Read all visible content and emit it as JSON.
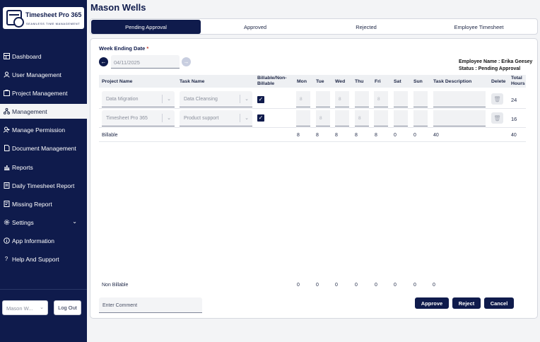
{
  "app": {
    "logo_title": "Timesheet Pro 365",
    "logo_subtitle": "SEAMLESS TIME MANAGEMENT"
  },
  "sidebar": {
    "items": [
      {
        "label": "Dashboard",
        "icon": "dashboard-icon"
      },
      {
        "label": "User Management",
        "icon": "user-icon"
      },
      {
        "label": "Project Management",
        "icon": "project-icon"
      },
      {
        "label": "Management",
        "icon": "hierarchy-icon",
        "active": true
      },
      {
        "label": "Manage Permission",
        "icon": "permission-icon"
      },
      {
        "label": "Document Management",
        "icon": "document-icon"
      },
      {
        "label": "Reports",
        "icon": "reports-icon"
      },
      {
        "label": "Daily Timesheet Report",
        "icon": "daily-report-icon"
      },
      {
        "label": "Missing Report",
        "icon": "missing-report-icon"
      },
      {
        "label": "Settings",
        "icon": "gear-icon"
      },
      {
        "label": "App Information",
        "icon": "info-icon"
      },
      {
        "label": "Help And Support",
        "icon": "help-icon"
      }
    ],
    "user_select": "Mason W...",
    "logout_label": "Log Out"
  },
  "header": {
    "title": "Mason Wells"
  },
  "tabs": [
    {
      "label": "Pending Approval",
      "active": true
    },
    {
      "label": "Approved"
    },
    {
      "label": "Rejected"
    },
    {
      "label": "Employee Timesheet"
    }
  ],
  "week": {
    "label": "Week Ending Date",
    "required_mark": "*",
    "date": "04/11/2025"
  },
  "employee": {
    "name_line": "Employee Name : Erika Geesey",
    "status_line": "Status : Pending Approval"
  },
  "table": {
    "headers": {
      "project": "Project Name",
      "task": "Task Name",
      "billable": "Billable/Non-Billable",
      "mon": "Mon",
      "tue": "Tue",
      "wed": "Wed",
      "thu": "Thu",
      "fri": "Fri",
      "sat": "Sat",
      "sun": "Sun",
      "desc": "Task Description",
      "delete": "Delete",
      "total": "Total Hours"
    },
    "rows": [
      {
        "project": "Data Migration",
        "task": "Data Cleansing",
        "billable": true,
        "days": [
          "8",
          "",
          "8",
          "",
          "8",
          "",
          ""
        ],
        "total": "24"
      },
      {
        "project": "Timesheet Pro 365",
        "task": "Product support",
        "billable": true,
        "days": [
          "",
          "8",
          "",
          "8",
          "",
          "",
          ""
        ],
        "total": "16"
      }
    ],
    "billable_summary": {
      "label": "Billable",
      "days": [
        "8",
        "8",
        "8",
        "8",
        "8",
        "0",
        "0"
      ],
      "desc_total": "40",
      "total": "40"
    },
    "nonbillable_summary": {
      "label": "Non Billable",
      "days": [
        "0",
        "0",
        "0",
        "0",
        "0",
        "0",
        "0"
      ],
      "desc_total": "0"
    }
  },
  "footer": {
    "comment_placeholder": "Enter Comment",
    "approve_label": "Approve",
    "reject_label": "Reject",
    "cancel_label": "Cancel"
  },
  "colors": {
    "brand": "#0f1b4c",
    "background": "#f3f4f6",
    "required": "#c0392b"
  }
}
